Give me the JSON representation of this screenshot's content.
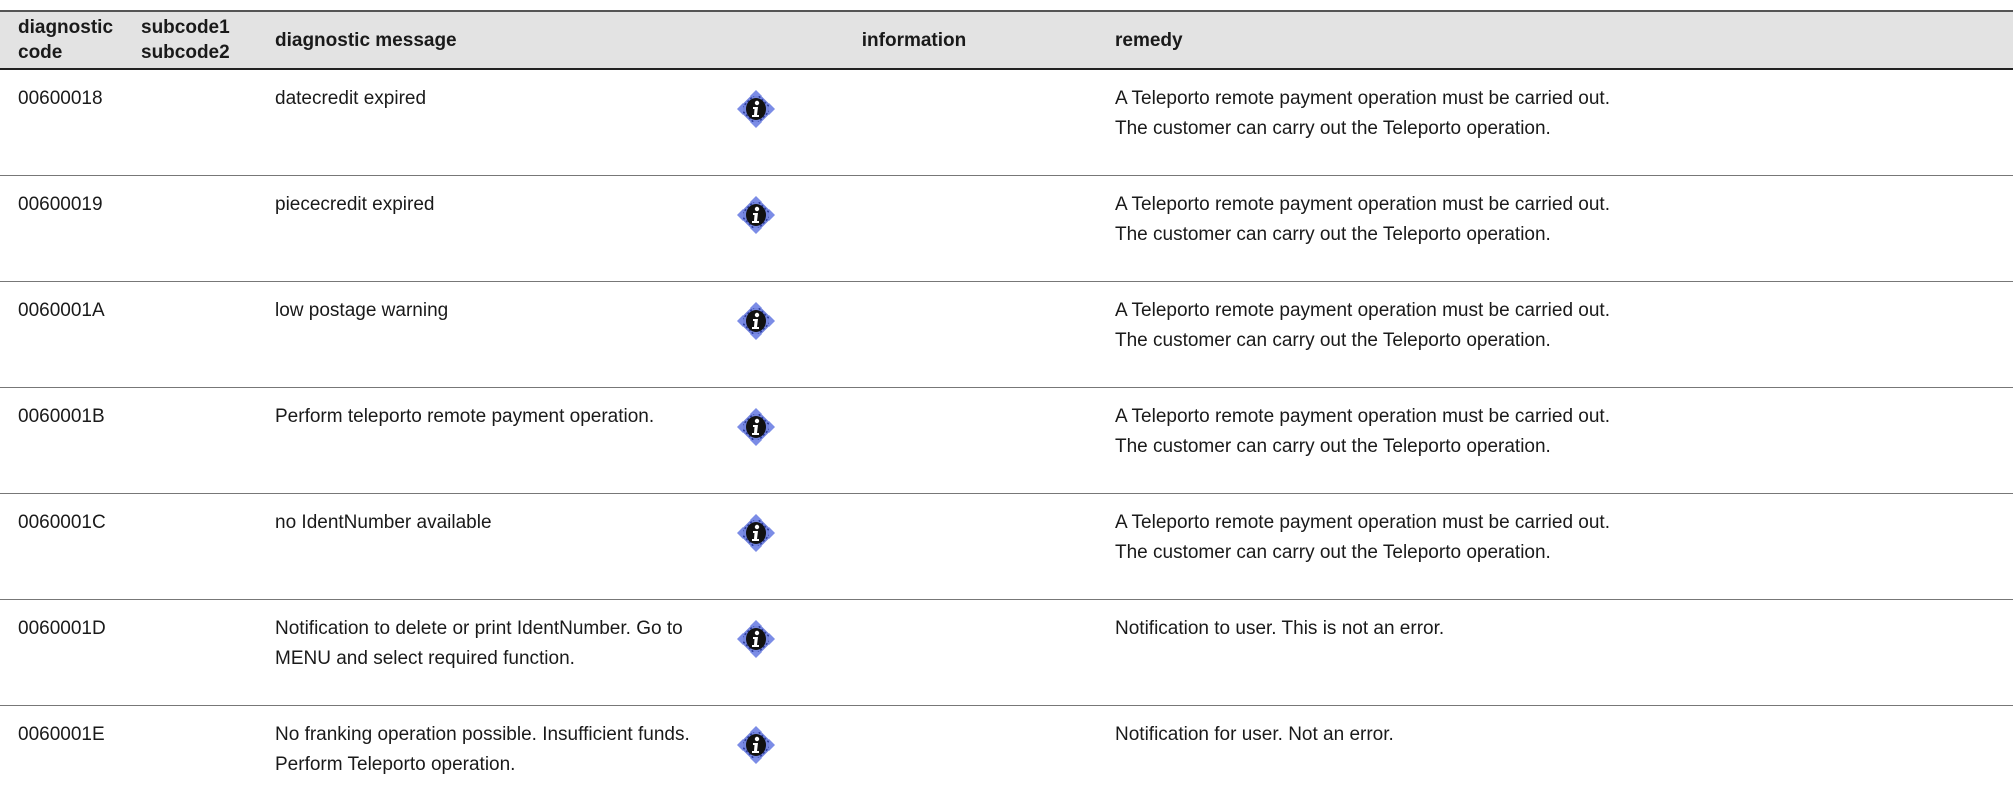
{
  "header": {
    "code": [
      "diagnostic",
      "code"
    ],
    "subcode": [
      "subcode1",
      "subcode2"
    ],
    "message": "diagnostic message",
    "information": "information",
    "remedy": "remedy"
  },
  "rows": [
    {
      "code": "00600018",
      "subcode": "",
      "message": "datecredit expired",
      "info_icon": "info-icon",
      "remedy": [
        "A Teleporto remote payment operation must be carried out.",
        "The customer can carry out the Teleporto operation."
      ]
    },
    {
      "code": "00600019",
      "subcode": "",
      "message": "piececredit expired",
      "info_icon": "info-icon",
      "remedy": [
        "A Teleporto remote payment operation must be carried out.",
        "The customer can carry out the Teleporto operation."
      ]
    },
    {
      "code": "0060001A",
      "subcode": "",
      "message": "low postage warning",
      "info_icon": "info-icon",
      "remedy": [
        "A Teleporto remote payment operation must be carried out.",
        "The customer can carry out the Teleporto operation."
      ]
    },
    {
      "code": "0060001B",
      "subcode": "",
      "message": "Perform teleporto remote payment operation.",
      "info_icon": "info-icon",
      "remedy": [
        "A Teleporto remote payment operation must be carried out.",
        "The customer can carry out the Teleporto operation."
      ]
    },
    {
      "code": "0060001C",
      "subcode": "",
      "message": "no IdentNumber available",
      "info_icon": "info-icon",
      "remedy": [
        "A Teleporto remote payment operation must be carried out.",
        "The customer can carry out the Teleporto operation."
      ]
    },
    {
      "code": "0060001D",
      "subcode": "",
      "message": "Notification to delete or print IdentNumber. Go to MENU and select required function.",
      "info_icon": "info-icon",
      "remedy": [
        "Notification to user. This is not an error."
      ]
    },
    {
      "code": "0060001E",
      "subcode": "",
      "message": "No franking operation possible. Insufficient funds. Perform Teleporto operation.",
      "info_icon": "info-icon",
      "remedy": [
        "Notification for user. Not an error."
      ]
    }
  ],
  "colors": {
    "header_bg": "#e3e3e3",
    "rule": "#777777",
    "icon_blue": "#5a6fd8"
  }
}
